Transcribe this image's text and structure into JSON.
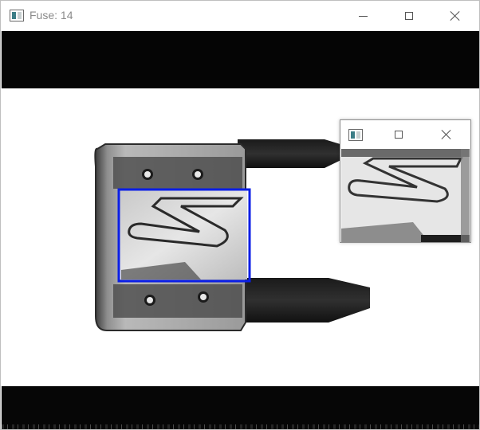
{
  "window": {
    "title": "Fuse: 14"
  },
  "subwindow": {
    "title": ""
  },
  "icons": {
    "app": "opencv-window-icon",
    "minimize": "minimize-icon",
    "maximize": "maximize-icon",
    "close": "close-icon"
  },
  "colors": {
    "roi_box": "#0a1ee6",
    "band": "#050505",
    "background": "#ffffff"
  }
}
